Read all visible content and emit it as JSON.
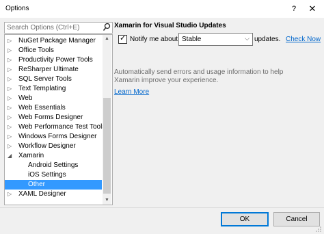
{
  "window": {
    "title": "Options",
    "help_label": "?",
    "close_label": "✕"
  },
  "search": {
    "placeholder": "Search Options (Ctrl+E)"
  },
  "tree": {
    "items": [
      {
        "label": "NuGet Package Manager",
        "arrow": "▷"
      },
      {
        "label": "Office Tools",
        "arrow": "▷"
      },
      {
        "label": "Productivity Power Tools",
        "arrow": "▷"
      },
      {
        "label": "ReSharper Ultimate",
        "arrow": "▷"
      },
      {
        "label": "SQL Server Tools",
        "arrow": "▷"
      },
      {
        "label": "Text Templating",
        "arrow": "▷"
      },
      {
        "label": "Web",
        "arrow": "▷"
      },
      {
        "label": "Web Essentials",
        "arrow": "▷"
      },
      {
        "label": "Web Forms Designer",
        "arrow": "▷"
      },
      {
        "label": "Web Performance Test Tools",
        "arrow": "▷"
      },
      {
        "label": "Windows Forms Designer",
        "arrow": "▷"
      },
      {
        "label": "Workflow Designer",
        "arrow": "▷"
      },
      {
        "label": "Xamarin",
        "arrow": "◢"
      },
      {
        "label": "Android Settings",
        "arrow": ""
      },
      {
        "label": "iOS Settings",
        "arrow": ""
      },
      {
        "label": "Other",
        "arrow": "",
        "selected": true
      },
      {
        "label": "XAML Designer",
        "arrow": "▷"
      }
    ]
  },
  "panel": {
    "title": "Xamarin for Visual Studio Updates",
    "notify_label": "Notify me about",
    "notify_checked": true,
    "channel_value": "Stable",
    "updates_label": "updates.",
    "check_now_label": "Check Now",
    "info_text": "Automatically send errors and usage information to help Xamarin improve your experience.",
    "learn_more_label": "Learn More"
  },
  "footer": {
    "ok_label": "OK",
    "cancel_label": "Cancel"
  },
  "colors": {
    "selection": "#3399ff",
    "link": "#0066cc",
    "focus_border": "#0078d7"
  }
}
